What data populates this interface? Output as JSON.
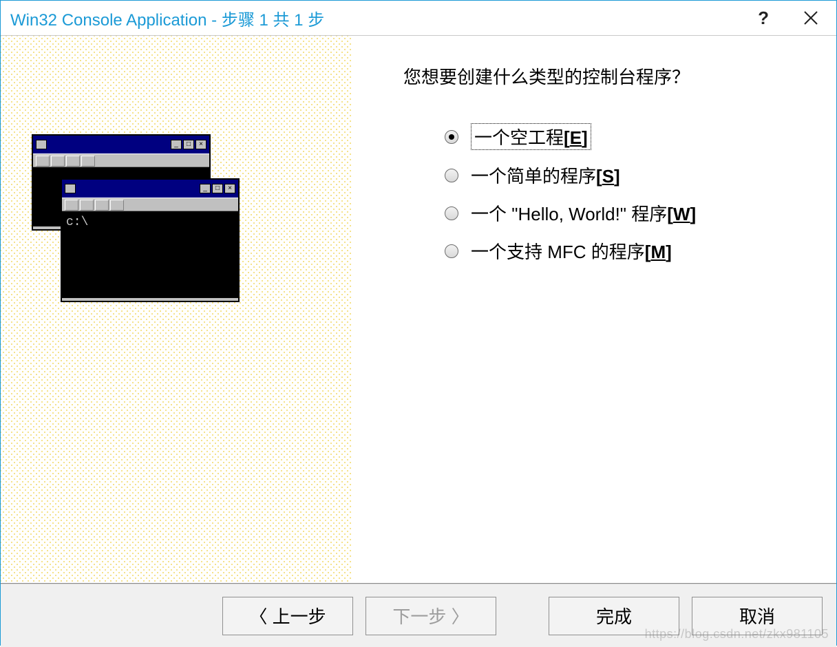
{
  "titlebar": {
    "title": "Win32 Console Application - 步骤 1 共 1 步",
    "help_symbol": "?",
    "close_label": "Close"
  },
  "main": {
    "question": "您想要创建什么类型的控制台程序？",
    "options": [
      {
        "label": "一个空工程",
        "mnemonic": "E",
        "checked": true
      },
      {
        "label": "一个简单的程序",
        "mnemonic": "S",
        "checked": false
      },
      {
        "label": "一个 \"Hello, World!\" 程序",
        "mnemonic": "W",
        "checked": false
      },
      {
        "label": "一个支持 MFC 的程序",
        "mnemonic": "M",
        "checked": false
      }
    ]
  },
  "illustration": {
    "front_prompt": "c:\\"
  },
  "footer": {
    "back": "上一步",
    "next": "下一步",
    "finish": "完成",
    "cancel": "取消"
  },
  "watermark": "https://blog.csdn.net/zkx981105"
}
